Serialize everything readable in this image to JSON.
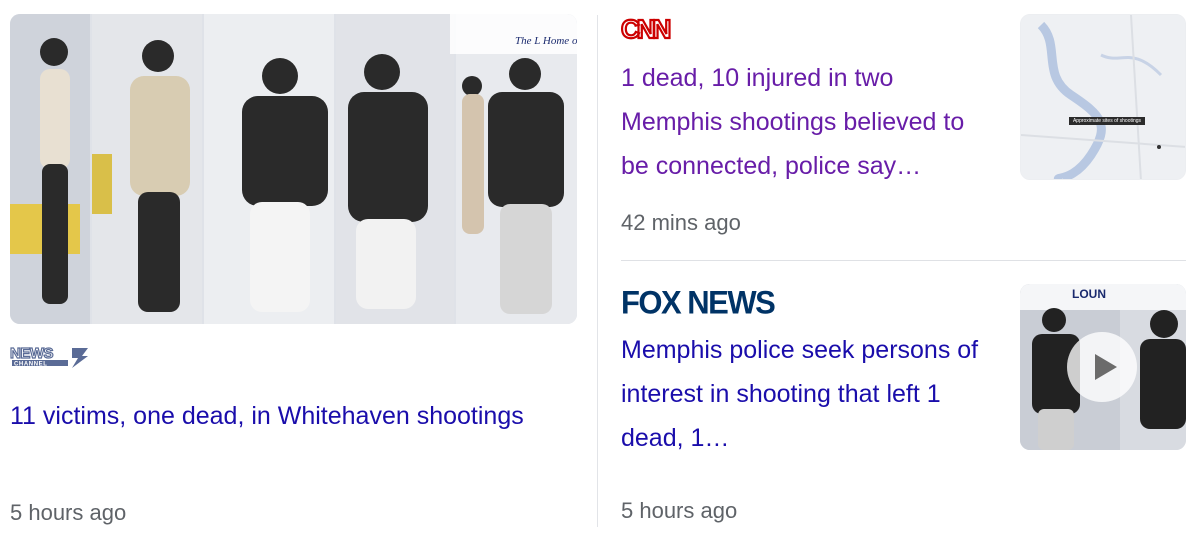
{
  "stories": [
    {
      "source": "NEWS CHANNEL 3",
      "title": "11 victims, one dead, in Whitehaven shootings",
      "time": "5 hours ago"
    },
    {
      "source": "CNN",
      "title": "1 dead, 10 injured in two Memphis shootings believed to be connected, police say…",
      "time": "42 mins ago",
      "map_label": "Approximate sites of shootings"
    },
    {
      "source": "FOX NEWS",
      "title": "Memphis police seek persons of interest in shooting that left 1 dead, 1…",
      "time": "5 hours ago"
    }
  ],
  "icons": {
    "play": "play-icon"
  },
  "colors": {
    "link_unvisited": "#1a0dab",
    "link_visited": "#681da8",
    "timestamp": "#5f6368",
    "cnn_red": "#cc0000",
    "fox_navy": "#003366"
  }
}
